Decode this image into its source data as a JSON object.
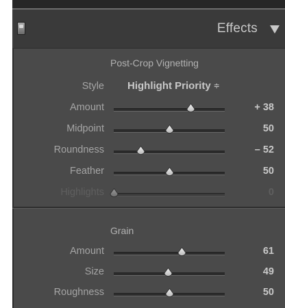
{
  "panel": {
    "title": "Effects",
    "toggle_icon": "panel-switch-icon",
    "disclosure_icon": "triangle-down-icon"
  },
  "vignetting": {
    "heading": "Post-Crop Vignetting",
    "style": {
      "label": "Style",
      "value": "Highlight Priority",
      "arrows": "≑"
    },
    "sliders": [
      {
        "label": "Amount",
        "value": "+ 38",
        "position": 0.69,
        "enabled": true
      },
      {
        "label": "Midpoint",
        "value": "50",
        "position": 0.5,
        "enabled": true
      },
      {
        "label": "Roundness",
        "value": "– 52",
        "position": 0.24,
        "enabled": true
      },
      {
        "label": "Feather",
        "value": "50",
        "position": 0.5,
        "enabled": true
      },
      {
        "label": "Highlights",
        "value": "0",
        "position": 0.0,
        "enabled": false
      }
    ]
  },
  "grain": {
    "heading": "Grain",
    "sliders": [
      {
        "label": "Amount",
        "value": "61",
        "position": 0.61,
        "enabled": true
      },
      {
        "label": "Size",
        "value": "49",
        "position": 0.49,
        "enabled": true
      },
      {
        "label": "Roughness",
        "value": "50",
        "position": 0.5,
        "enabled": true
      }
    ]
  }
}
